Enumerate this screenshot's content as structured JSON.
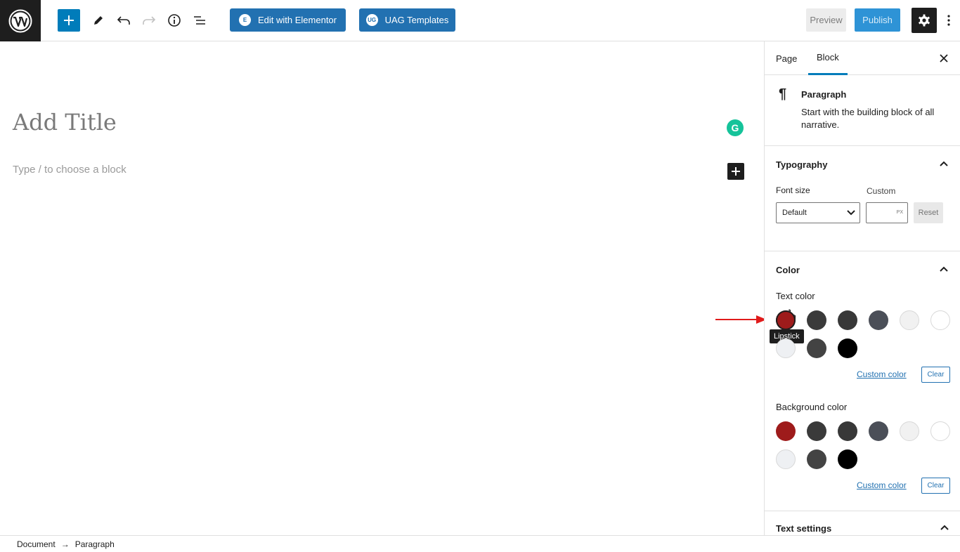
{
  "toolbar": {
    "elementor_label": "Edit with Elementor",
    "elementor_badge": "E",
    "uag_label": "UAG Templates",
    "uag_badge": "UG",
    "preview_label": "Preview",
    "publish_label": "Publish"
  },
  "editor": {
    "title_placeholder": "Add Title",
    "block_placeholder": "Type / to choose a block",
    "grammarly_letter": "G"
  },
  "sidebar": {
    "tabs": [
      {
        "label": "Page"
      },
      {
        "label": "Block"
      }
    ],
    "block_card": {
      "title": "Paragraph",
      "description": "Start with the building block of all narrative."
    },
    "typography": {
      "title": "Typography",
      "font_size_label": "Font size",
      "custom_label": "Custom",
      "select_value": "Default",
      "unit": "PX",
      "reset_label": "Reset"
    },
    "color": {
      "title": "Color",
      "text_color_label": "Text color",
      "background_color_label": "Background color",
      "custom_color_label": "Custom color",
      "clear_label": "Clear",
      "tooltip": "Lipstick",
      "palette": [
        "#9e1b1b",
        "#3a3a3a",
        "#383838",
        "#4b4f58",
        "#f1f1f1",
        "#ffffff",
        "#eef0f3",
        "#434343",
        "#000000"
      ]
    },
    "text_settings": {
      "title": "Text settings"
    }
  },
  "breadcrumb": {
    "items": [
      "Document",
      "Paragraph"
    ],
    "separator": "→"
  },
  "colors": {
    "accent": "#007cba",
    "wp_dark": "#1e1e1e"
  }
}
